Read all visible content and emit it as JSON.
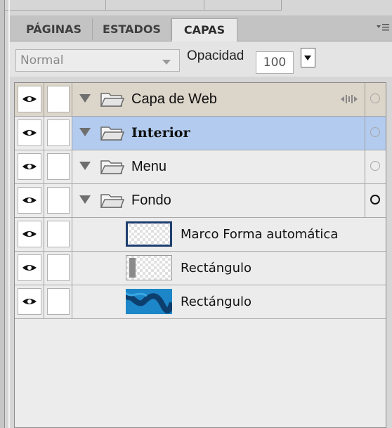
{
  "tabs": [
    {
      "label": "PÁGINAS",
      "active": false
    },
    {
      "label": "ESTADOS",
      "active": false
    },
    {
      "label": "CAPAS",
      "active": true
    }
  ],
  "toolbar": {
    "blend_mode": "Normal",
    "opacity_label": "Opacidad",
    "opacity_value": "100"
  },
  "layers": [
    {
      "type": "layer",
      "name": "Capa de Web",
      "expanded": true,
      "highlight": "tan",
      "target": "circle-light",
      "visible": true
    },
    {
      "type": "layer",
      "name": "Interior",
      "expanded": true,
      "highlight": "selected",
      "target": "circle-light",
      "visible": true,
      "bold": true
    },
    {
      "type": "layer",
      "name": "Menu",
      "expanded": true,
      "highlight": "none",
      "target": "circle-light",
      "visible": true
    },
    {
      "type": "layer",
      "name": "Fondo",
      "expanded": true,
      "highlight": "none",
      "target": "circle-dark",
      "visible": true
    },
    {
      "type": "object",
      "name": "Marco Forma automática",
      "thumb": "autoshape-frame",
      "visible": true
    },
    {
      "type": "object",
      "name": "Rectángulo",
      "thumb": "rect-gray",
      "visible": true
    },
    {
      "type": "object",
      "name": "Rectángulo",
      "thumb": "rect-blue",
      "visible": true
    }
  ],
  "colors": {
    "selected_row": "#b2cbef",
    "tan_row": "#dcd5c9",
    "panel_bg": "#d6d6d6",
    "list_bg": "#ececec"
  },
  "icons": {
    "visibility": "eye-icon",
    "folder": "folder-icon",
    "expand": "triangle-down-icon",
    "target": "circle-icon",
    "distribute": "distribute-icon",
    "panel_menu": "panel-menu-icon"
  }
}
